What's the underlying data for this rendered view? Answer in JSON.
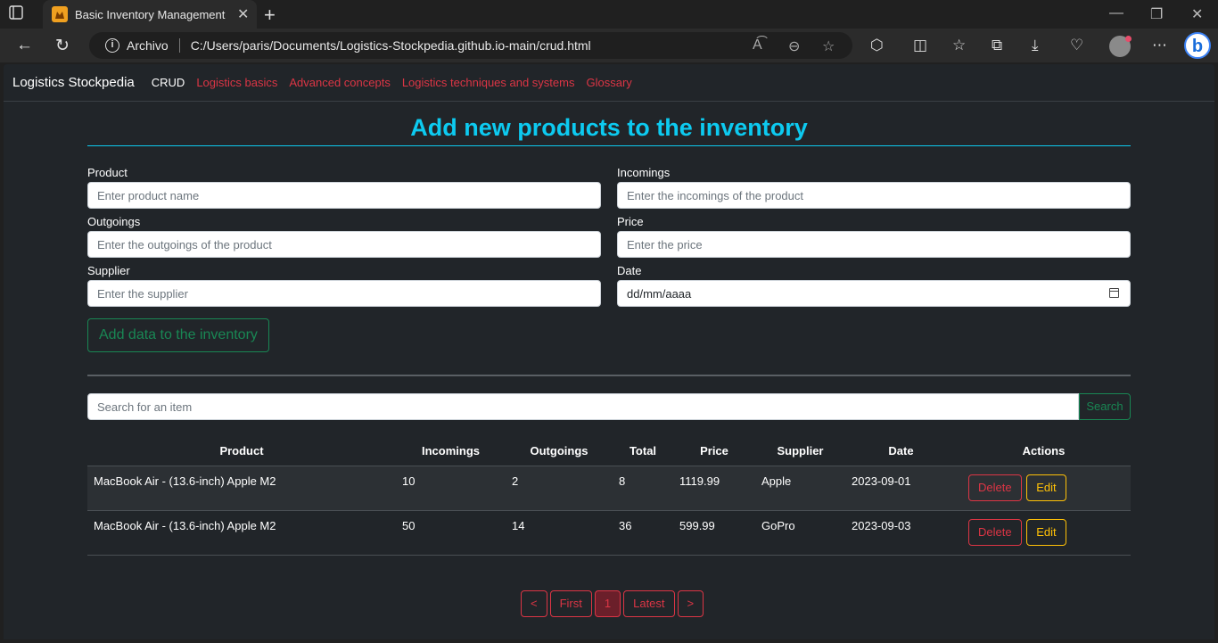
{
  "browser": {
    "tab_title": "Basic Inventory Management (CRUD)",
    "site_label": "Archivo",
    "url": "C:/Users/paris/Documents/Logistics-Stockpedia.github.io-main/crud.html"
  },
  "navbar": {
    "brand": "Logistics Stockpedia",
    "links": [
      {
        "label": "CRUD",
        "active": true
      },
      {
        "label": "Logistics basics"
      },
      {
        "label": "Advanced concepts"
      },
      {
        "label": "Logistics techniques and systems"
      },
      {
        "label": "Glossary"
      }
    ]
  },
  "form": {
    "title": "Add new products to the inventory",
    "fields": [
      {
        "label": "Product",
        "placeholder": "Enter product name"
      },
      {
        "label": "Incomings",
        "placeholder": "Enter the incomings of the product"
      },
      {
        "label": "Outgoings",
        "placeholder": "Enter the outgoings of the product"
      },
      {
        "label": "Price",
        "placeholder": "Enter the price"
      },
      {
        "label": "Supplier",
        "placeholder": "Enter the supplier"
      },
      {
        "label": "Date",
        "value": "dd/mm/aaaa"
      }
    ],
    "submit_label": "Add data to the inventory"
  },
  "search": {
    "placeholder": "Search for an item",
    "button_label": "Search"
  },
  "table": {
    "headers": [
      "Product",
      "Incomings",
      "Outgoings",
      "Total",
      "Price",
      "Supplier",
      "Date",
      "Actions"
    ],
    "rows": [
      {
        "product": "MacBook Air - (13.6-inch) Apple M2",
        "incomings": "10",
        "outgoings": "2",
        "total": "8",
        "price": "1119.99",
        "supplier": "Apple",
        "date": "2023-09-01"
      },
      {
        "product": "MacBook Air - (13.6-inch) Apple M2",
        "incomings": "50",
        "outgoings": "14",
        "total": "36",
        "price": "599.99",
        "supplier": "GoPro",
        "date": "2023-09-03"
      }
    ],
    "delete_label": "Delete",
    "edit_label": "Edit"
  },
  "pagination": {
    "prev": "<",
    "first": "First",
    "current": "1",
    "latest": "Latest",
    "next": ">"
  },
  "colors": {
    "accent_cyan": "#0dcaf0",
    "success": "#198754",
    "danger": "#dc3545",
    "warning": "#ffc107"
  }
}
